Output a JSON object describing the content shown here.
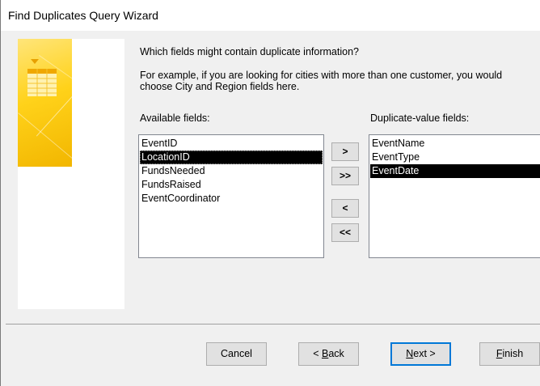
{
  "window": {
    "title": "Find Duplicates Query Wizard"
  },
  "content": {
    "question": "Which fields might contain duplicate information?",
    "example_line1": "For example, if you are looking for cities with more than one customer, you would",
    "example_line2": "choose City and Region fields here.",
    "available_label": "Available fields:",
    "duplicate_label": "Duplicate-value fields:"
  },
  "available_fields": [
    {
      "label": "EventID",
      "selected": false
    },
    {
      "label": "LocationID",
      "selected": true
    },
    {
      "label": "FundsNeeded",
      "selected": false
    },
    {
      "label": "FundsRaised",
      "selected": false
    },
    {
      "label": "EventCoordinator",
      "selected": false
    }
  ],
  "duplicate_fields": [
    {
      "label": "EventName",
      "selected": false
    },
    {
      "label": "EventType",
      "selected": false
    },
    {
      "label": "EventDate",
      "selected": true
    }
  ],
  "move_buttons": {
    "add_one": ">",
    "add_all": ">>",
    "remove_one": "<",
    "remove_all": "<<"
  },
  "footer": {
    "cancel": "Cancel",
    "back_prefix": "< ",
    "back_key": "B",
    "back_rest": "ack",
    "next_key": "N",
    "next_rest": "ext >",
    "finish_key": "F",
    "finish_rest": "inish"
  },
  "colors": {
    "selection_bg": "#000000",
    "accent": "#0078d7",
    "hero_yellow": "#ffd21a"
  }
}
